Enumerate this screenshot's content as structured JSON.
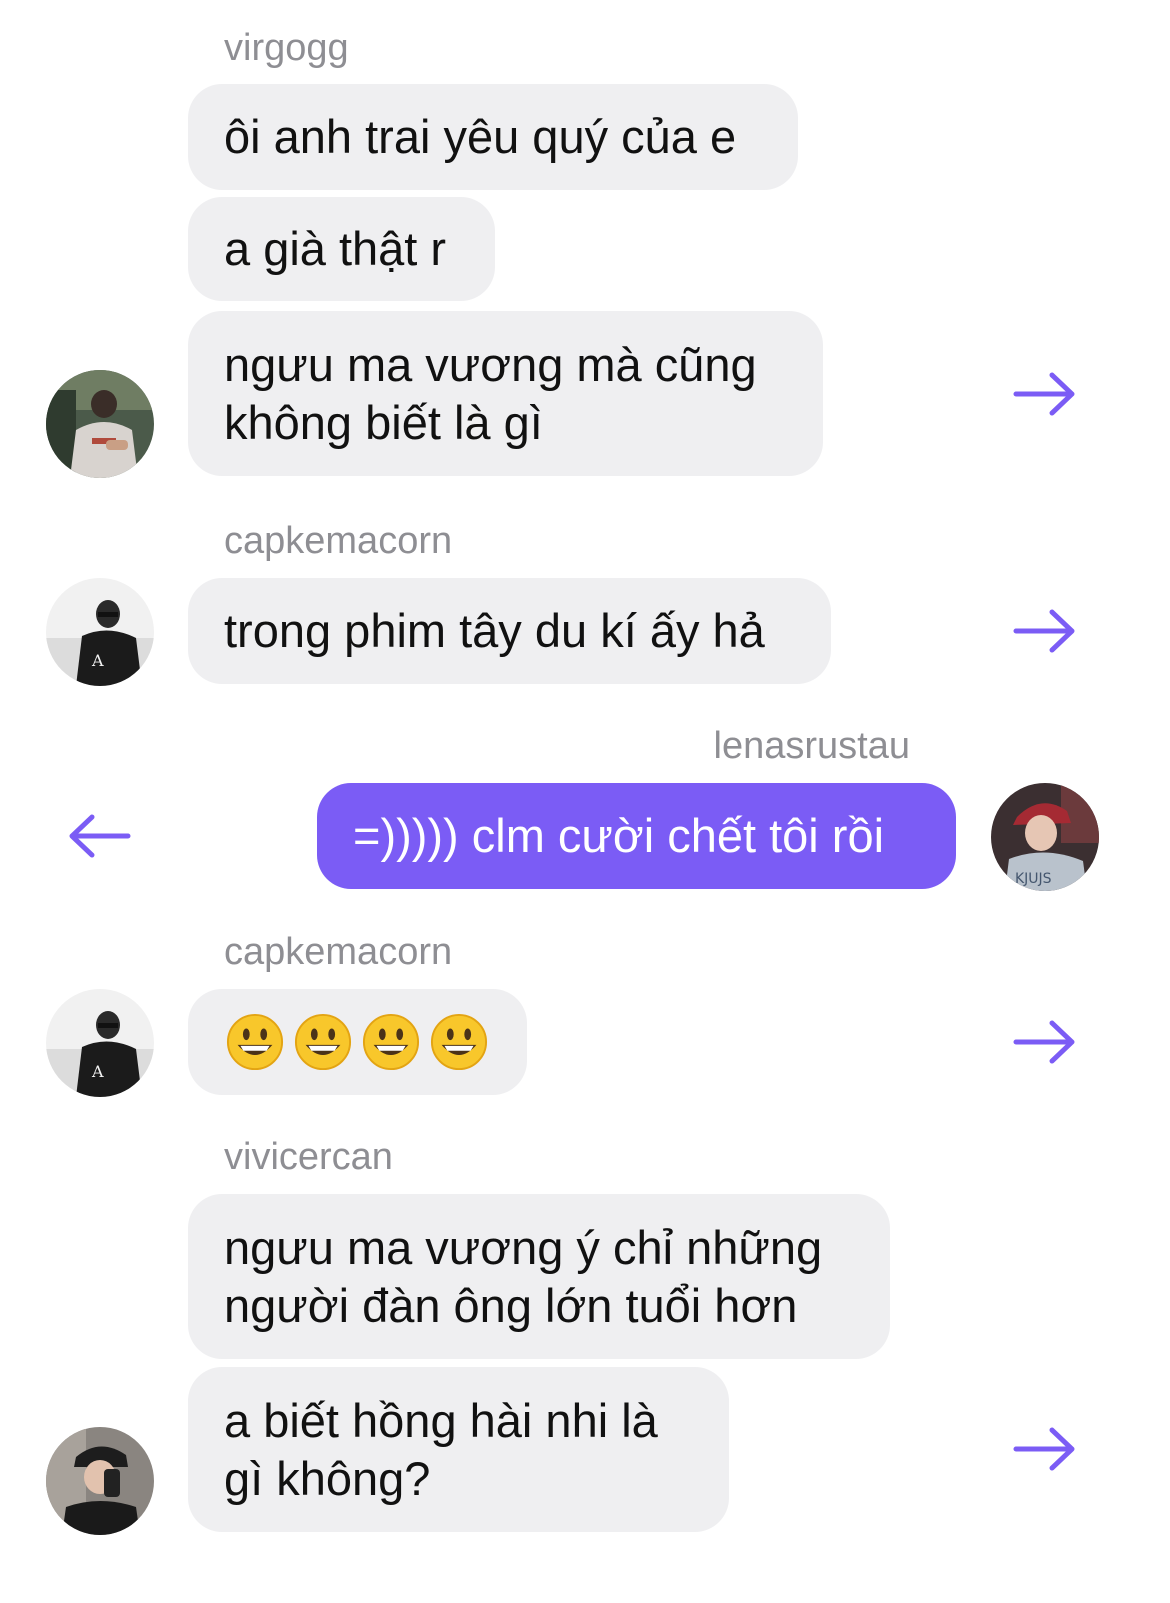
{
  "accent_color": "#7b5cf5",
  "bubble_color": "#efeff1",
  "messages": [
    {
      "sender": "virgogg",
      "bubbles": [
        "ôi anh trai yêu quý của e",
        "a già thật r",
        "ngưu ma vương mà cũng\nkhông biết là gì"
      ],
      "action_icon": "forward-arrow-icon"
    },
    {
      "sender": "capkemacorn",
      "bubbles": [
        "trong phim tây du kí ấy hả"
      ],
      "action_icon": "forward-arrow-icon"
    },
    {
      "sender": "lenasrustau",
      "bubbles": [
        "=))))) clm cười chết tôi rồi"
      ],
      "action_icon": "back-arrow-icon",
      "outgoing": true
    },
    {
      "sender": "capkemacorn",
      "bubbles": [
        "😀😀😀😀"
      ],
      "action_icon": "forward-arrow-icon"
    },
    {
      "sender": "vivicercan",
      "bubbles": [
        "ngưu ma vương ý chỉ những\nngười đàn ông lớn tuổi hơn",
        "a biết hồng hài nhi là\ngì không?"
      ],
      "action_icon": "forward-arrow-icon"
    }
  ]
}
